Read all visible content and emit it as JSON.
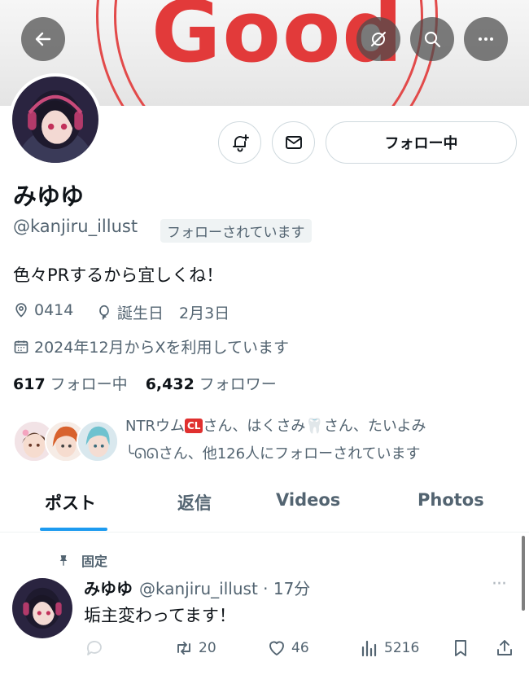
{
  "banner": {
    "text": "Good"
  },
  "header": {
    "back_icon": "arrow-left-icon",
    "nav_icons": [
      "no-translate-icon",
      "search-icon",
      "more-icon"
    ]
  },
  "actions": {
    "notify_icon": "bell-plus-icon",
    "message_icon": "envelope-icon",
    "follow_label": "フォロー中"
  },
  "profile": {
    "name": "みゆゆ",
    "handle": "@kanjiru_illust",
    "follows_you": "フォローされています",
    "bio": "色々PRするから宜しくね！",
    "location": "0414",
    "birthday": "誕生日　2月3日",
    "joined": "2024年12月からXを利用しています"
  },
  "counts": {
    "following_num": "617",
    "following_label": "フォロー中",
    "followers_num": "6,432",
    "followers_label": "フォロワー"
  },
  "followed_by": {
    "part1": "NTRウム",
    "badge": "CL",
    "part2": "さん、はくさみ",
    "tooth": "🦷",
    "part3": "さん、たいよみ",
    "line2": "╰ᘏᘏさん、他126人にフォローされています"
  },
  "tabs": [
    "ポスト",
    "返信",
    "Videos",
    "Photos"
  ],
  "post": {
    "pinned_label": "固定",
    "name": "みゆゆ",
    "handle_time": "@kanjiru_illust · 17分",
    "text": "垢主変わってます！",
    "more": "···",
    "retweets": "20",
    "likes": "46",
    "views": "5216"
  },
  "colors": {
    "accent": "#1d9bf0",
    "banner_red": "#e23a3a"
  }
}
